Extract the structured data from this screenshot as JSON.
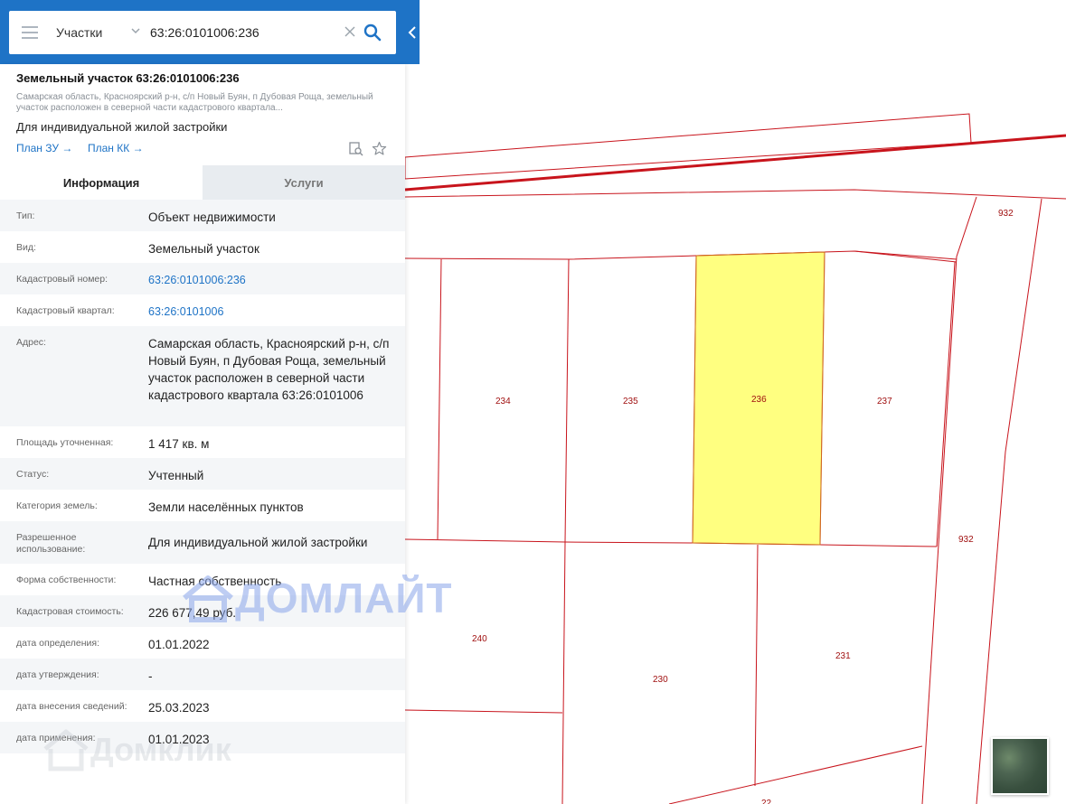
{
  "search": {
    "layer": "Участки",
    "query": "63:26:0101006:236"
  },
  "parcel": {
    "title": "Земельный участок 63:26:0101006:236",
    "address_short": "Самарская область, Красноярский р-н, с/п Новый Буян, п Дубовая Роща, земельный участок расположен в северной части кадастрового квартала...",
    "purpose": "Для индивидуальной жилой застройки",
    "plan_zu": "План ЗУ →",
    "plan_kk": "План КК →"
  },
  "tabs": {
    "info": "Информация",
    "services": "Услуги"
  },
  "attributes": [
    {
      "key": "Тип:",
      "value": "Объект недвижимости"
    },
    {
      "key": "Вид:",
      "value": "Земельный участок"
    },
    {
      "key": "Кадастровый номер:",
      "value": "63:26:0101006:236"
    },
    {
      "key": "Кадастровый квартал:",
      "value": "63:26:0101006"
    },
    {
      "key": "Адрес:",
      "value": "Самарская область, Красноярский р-н, с/п Новый Буян, п Дубовая Роща, земельный участок расположен в северной части кадастрового квартала 63:26:0101006"
    },
    {
      "key": "Площадь уточненная:",
      "value": "1 417 кв. м"
    },
    {
      "key": "Статус:",
      "value": "Учтенный"
    },
    {
      "key": "Категория земель:",
      "value": "Земли населённых пунктов"
    },
    {
      "key": "Разрешенное использование:",
      "value": "Для индивидуальной жилой застройки"
    },
    {
      "key": "Форма собственности:",
      "value": "Частная собственность"
    },
    {
      "key": "Кадастровая стоимость:",
      "value": "226 677,49 руб."
    },
    {
      "key": "дата определения:",
      "value": "01.01.2022"
    },
    {
      "key": "дата утверждения:",
      "value": "-"
    },
    {
      "key": "дата внесения сведений:",
      "value": "25.03.2023"
    },
    {
      "key": "дата применения:",
      "value": "01.01.2023"
    }
  ],
  "map": {
    "plots": [
      "932",
      "234",
      "235",
      "236",
      "237",
      "932",
      "240",
      "230",
      "231",
      "22"
    ],
    "selected_plot": "236",
    "boundary_color": "#c8141c",
    "selected_fill": "#ffff80"
  },
  "watermarks": {
    "domlight": "ДОМЛАЙТ",
    "domclick": "Домклик"
  },
  "colors": {
    "header": "#1e73c6",
    "link": "#1e73c6",
    "tab_inactive": "#e8ecf0"
  }
}
